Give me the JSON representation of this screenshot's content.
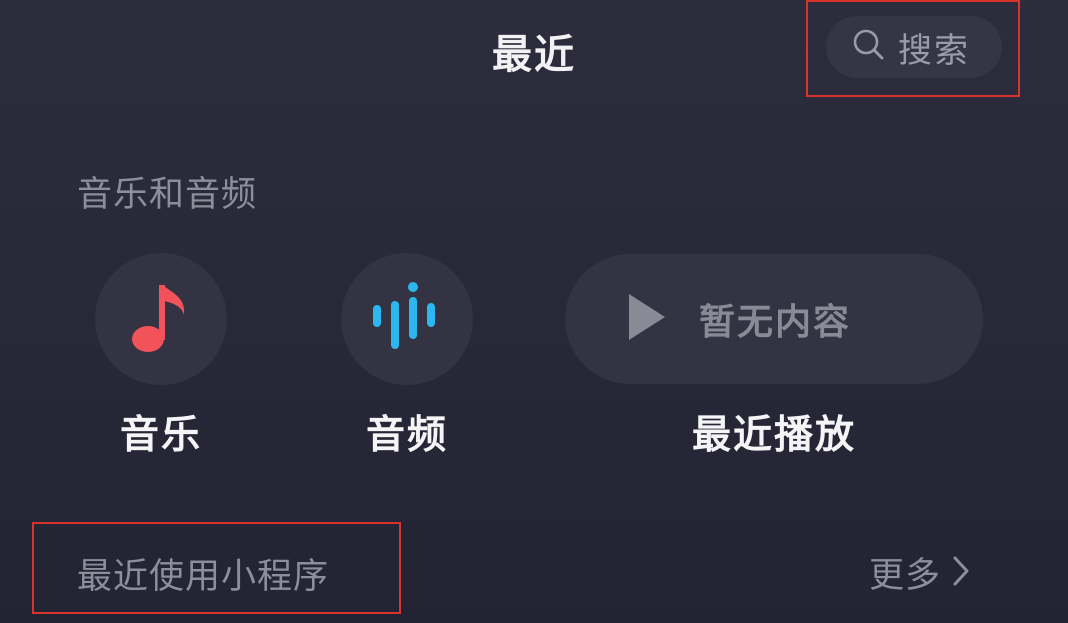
{
  "header": {
    "title": "最近",
    "search_label": "搜索"
  },
  "music_audio": {
    "section_title": "音乐和音频",
    "items": [
      {
        "label": "音乐",
        "icon": "music-note-icon",
        "color": "#f2525a"
      },
      {
        "label": "音频",
        "icon": "audio-wave-icon",
        "color": "#2cb7f0"
      }
    ],
    "recent_play": {
      "label": "最近播放",
      "empty_text": "暂无内容",
      "icon": "play-icon"
    }
  },
  "mini_programs": {
    "section_title": "最近使用小程序",
    "more_label": "更多"
  },
  "colors": {
    "highlight": "#d9332a",
    "background": "#2a2a3a"
  }
}
